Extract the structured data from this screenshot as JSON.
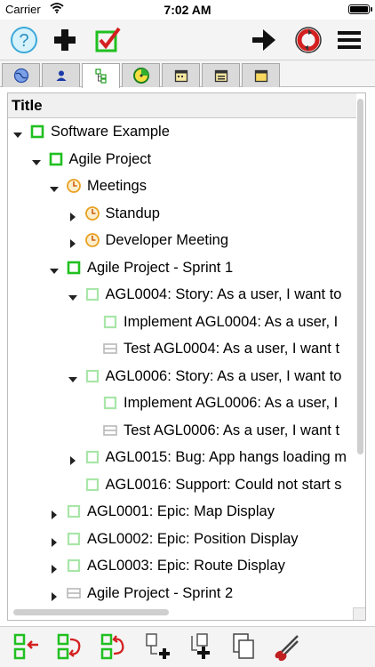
{
  "status": {
    "carrier": "Carrier",
    "time": "7:02 AM"
  },
  "toolbar": {
    "left": [
      "help-icon",
      "add-icon",
      "checkmark-icon"
    ],
    "right": [
      "forward-arrow-icon",
      "sync-icon",
      "menu-icon"
    ]
  },
  "tabs": [
    "globe-tab",
    "user-tab",
    "tree-tab",
    "timer-tab",
    "calendar-tab-1",
    "calendar-tab-2",
    "calendar-tab-3"
  ],
  "tree": {
    "header": "Title",
    "rows": [
      {
        "label": "Software Example",
        "depth": 0,
        "arrow": "down",
        "icon": "green-square"
      },
      {
        "label": "Agile Project",
        "depth": 1,
        "arrow": "down",
        "icon": "green-square"
      },
      {
        "label": "Meetings",
        "depth": 2,
        "arrow": "down",
        "icon": "clock"
      },
      {
        "label": "Standup",
        "depth": 3,
        "arrow": "right",
        "icon": "clock"
      },
      {
        "label": "Developer Meeting",
        "depth": 3,
        "arrow": "right",
        "icon": "clock"
      },
      {
        "label": "Agile Project - Sprint 1",
        "depth": 2,
        "arrow": "down",
        "icon": "green-square"
      },
      {
        "label": "AGL0004: Story: As a user, I want to",
        "depth": 3,
        "arrow": "down",
        "icon": "light-square"
      },
      {
        "label": "Implement AGL0004: As a user, I",
        "depth": 4,
        "arrow": "none",
        "icon": "light-square"
      },
      {
        "label": "Test AGL0004: As a user, I want t",
        "depth": 4,
        "arrow": "none",
        "icon": "gray-lines"
      },
      {
        "label": "AGL0006: Story: As a user, I want to",
        "depth": 3,
        "arrow": "down",
        "icon": "light-square"
      },
      {
        "label": "Implement AGL0006: As a user, I",
        "depth": 4,
        "arrow": "none",
        "icon": "light-square"
      },
      {
        "label": "Test AGL0006: As a user, I want t",
        "depth": 4,
        "arrow": "none",
        "icon": "gray-lines"
      },
      {
        "label": "AGL0015: Bug: App hangs loading m",
        "depth": 3,
        "arrow": "right",
        "icon": "light-square"
      },
      {
        "label": "AGL0016: Support: Could not start s",
        "depth": 3,
        "arrow": "none",
        "icon": "light-square"
      },
      {
        "label": "AGL0001: Epic: Map Display",
        "depth": 2,
        "arrow": "right",
        "icon": "light-square"
      },
      {
        "label": "AGL0002: Epic: Position Display",
        "depth": 2,
        "arrow": "right",
        "icon": "light-square"
      },
      {
        "label": "AGL0003: Epic: Route Display",
        "depth": 2,
        "arrow": "right",
        "icon": "light-square"
      },
      {
        "label": "Agile Project - Sprint 2",
        "depth": 2,
        "arrow": "right",
        "icon": "gray-lines"
      }
    ]
  },
  "bottombar": [
    "insert-before-icon",
    "move-down-icon",
    "move-up-icon",
    "add-child-icon",
    "add-sibling-icon",
    "copy-icon",
    "cut-icon"
  ],
  "colors": {
    "green": "#20c020",
    "lightGreen": "#a8e6a8",
    "orange": "#e8a020",
    "red": "#d42020"
  }
}
